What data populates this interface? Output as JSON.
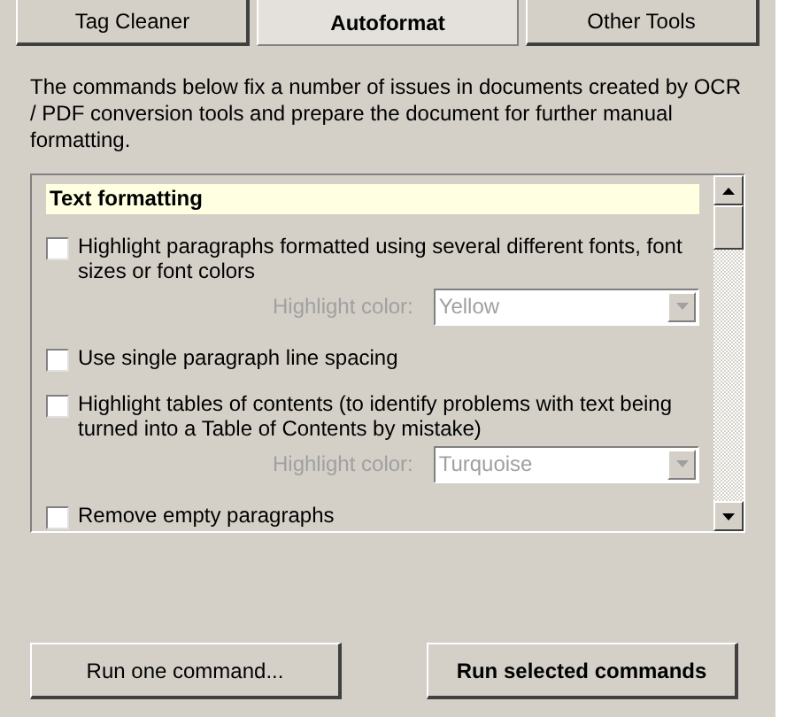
{
  "tabs": [
    {
      "label": "Tag Cleaner",
      "selected": false
    },
    {
      "label": "Autoformat",
      "selected": true
    },
    {
      "label": "Other Tools",
      "selected": false
    }
  ],
  "description": "The commands below fix a number of issues in documents created by OCR / PDF conversion tools and prepare the document for further manual formatting.",
  "command_list": {
    "section": "Text formatting",
    "items": [
      {
        "kind": "checkbox",
        "label": "Highlight paragraphs formatted using several different fonts, font sizes or font colors",
        "checked": false
      },
      {
        "kind": "color",
        "label": "Highlight color:",
        "value": "Yellow",
        "disabled": true
      },
      {
        "kind": "checkbox",
        "label": "Use single paragraph line spacing",
        "checked": false
      },
      {
        "kind": "checkbox",
        "label": "Highlight tables of contents (to identify problems with text being turned into a Table of Contents by mistake)",
        "checked": false
      },
      {
        "kind": "color",
        "label": "Highlight color:",
        "value": "Turquoise",
        "disabled": true
      },
      {
        "kind": "checkbox",
        "label": "Remove empty paragraphs",
        "checked": false
      }
    ]
  },
  "buttons": [
    {
      "label": "Run one command...",
      "default": false
    },
    {
      "label": "Run selected commands",
      "default": true
    }
  ]
}
